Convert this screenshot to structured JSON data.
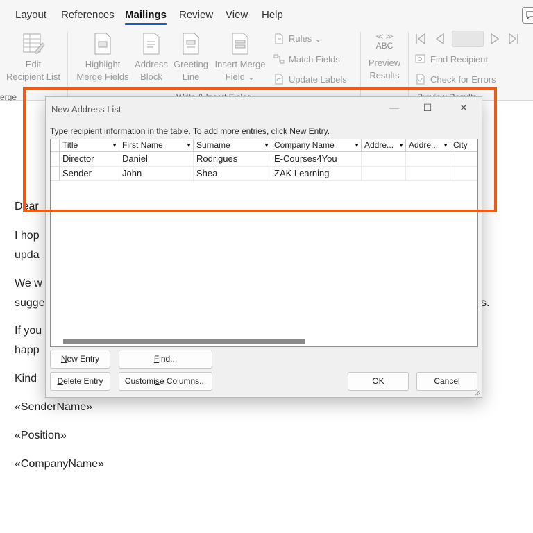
{
  "tabs": [
    {
      "label": "Layout"
    },
    {
      "label": "References"
    },
    {
      "label": "Mailings",
      "active": true
    },
    {
      "label": "Review"
    },
    {
      "label": "View"
    },
    {
      "label": "Help"
    }
  ],
  "ribbon": {
    "edit_recipient": {
      "line1": "Edit",
      "line2": "Recipient List"
    },
    "highlight_fields": {
      "line1": "Highlight",
      "line2": "Merge Fields"
    },
    "address_block": {
      "line1": "Address",
      "line2": "Block"
    },
    "greeting_line": {
      "line1": "Greeting",
      "line2": "Line"
    },
    "insert_merge": {
      "line1": "Insert Merge",
      "line2": "Field ⌄"
    },
    "rules": "Rules ⌄",
    "match_fields": "Match Fields",
    "update_labels": "Update Labels",
    "preview_abc": "ABC",
    "preview": {
      "line1": "Preview",
      "line2": "Results"
    },
    "find_recipient": "Find Recipient",
    "check_errors": "Check for Errors",
    "group_merge": "erge",
    "group_write": "Write & Insert Fields",
    "group_preview": "Preview Results"
  },
  "document": {
    "lines": [
      "Dear",
      "I hop",
      "upda",
      "We w",
      "sugge",
      "s.",
      "If you",
      "happ",
      "Kind",
      "«SenderName»",
      "«Position»",
      "«CompanyName»"
    ]
  },
  "dialog": {
    "title": "New Address List",
    "minimize": "—",
    "maximize": "☐",
    "close": "✕",
    "instruction_first": "T",
    "instruction_rest": "ype recipient information in the table.  To add more entries, click New Entry.",
    "columns": [
      "Title",
      "First Name",
      "Surname",
      "Company Name",
      "Addre...",
      "Addre...",
      "City"
    ],
    "rows": [
      [
        "Director",
        "Daniel",
        "Rodrigues",
        "E-Courses4You",
        "",
        "",
        ""
      ],
      [
        "Sender",
        "John",
        "Shea",
        "ZAK Learning",
        "",
        "",
        ""
      ]
    ],
    "buttons": {
      "new_entry_u": "N",
      "new_entry_rest": "ew Entry",
      "find_u": "F",
      "find_rest": "ind...",
      "delete_u": "D",
      "delete_rest": "elete Entry",
      "customise_pre": "Customi",
      "customise_u": "s",
      "customise_rest": "e Columns...",
      "ok": "OK",
      "cancel": "Cancel"
    }
  },
  "colors": {
    "accent": "#185abd",
    "highlight": "#f05a12"
  }
}
